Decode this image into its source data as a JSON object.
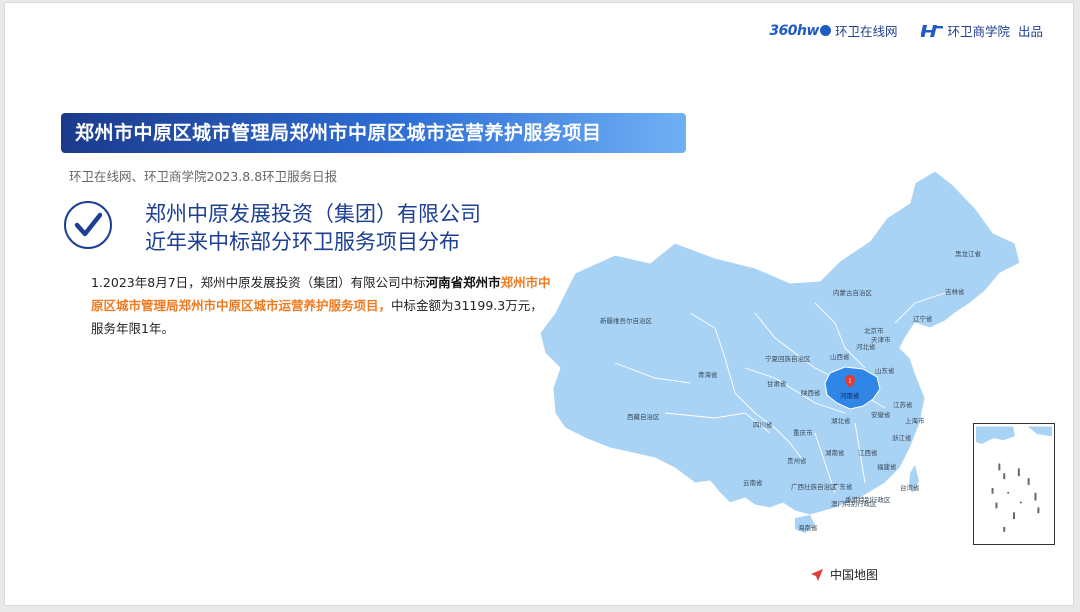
{
  "header": {
    "logo1_mark": "360hw",
    "logo1_text": "环卫在线网",
    "logo2_text": "环卫商学院",
    "logo2_suffix": "出品"
  },
  "banner": {
    "title": "郑州市中原区城市管理局郑州市中原区城市运营养护服务项目"
  },
  "source": "环卫在线网、环卫商学院2023.8.8环卫服务日报",
  "company": {
    "line1": "郑州中原发展投资（集团）有限公司",
    "line2": "近年来中标部分环卫服务项目分布"
  },
  "description": {
    "part1": "1.2023年8月7日，郑州中原发展投资（集团）有限公司中标",
    "part2_bold": "河南省郑州市",
    "part3_highlight": "郑州市中原区城市管理局郑州市中原区城市运营养护服务项目，",
    "part4": "中标金额为31199.3万元，服务年限1年。"
  },
  "map": {
    "highlight_color": "#2f86e6",
    "base_color": "#a9d3f5",
    "highlight_province": "河南省",
    "pin_label": "1",
    "labels": {
      "heilongjiang": "黑龙江省",
      "jilin": "吉林省",
      "liaoning": "辽宁省",
      "neimenggu": "内蒙古自治区",
      "xinjiang": "新疆维吾尔自治区",
      "beijing": "北京市",
      "tianjin": "天津市",
      "hebei": "河北省",
      "shanxi": "山西省",
      "shandong": "山东省",
      "ningxia": "宁夏回族自治区",
      "qinghai": "青海省",
      "gansu": "甘肃省",
      "shaanxi": "陕西省",
      "henan": "河南省",
      "jiangsu": "江苏省",
      "anhui": "安徽省",
      "shanghai": "上海市",
      "xizang": "西藏自治区",
      "sichuan": "四川省",
      "hubei": "湖北省",
      "chongqing": "重庆市",
      "zhejiang": "浙江省",
      "hunan": "湖南省",
      "jiangxi": "江西省",
      "guizhou": "贵州省",
      "fujian": "福建省",
      "yunnan": "云南省",
      "guangxi": "广西壮族自治区",
      "guangdong": "广东省",
      "taiwan": "台湾省",
      "hongkong": "香港特别行政区",
      "macau": "澳门特别行政区",
      "hainan": "海南省"
    },
    "caption": "中国地图"
  }
}
